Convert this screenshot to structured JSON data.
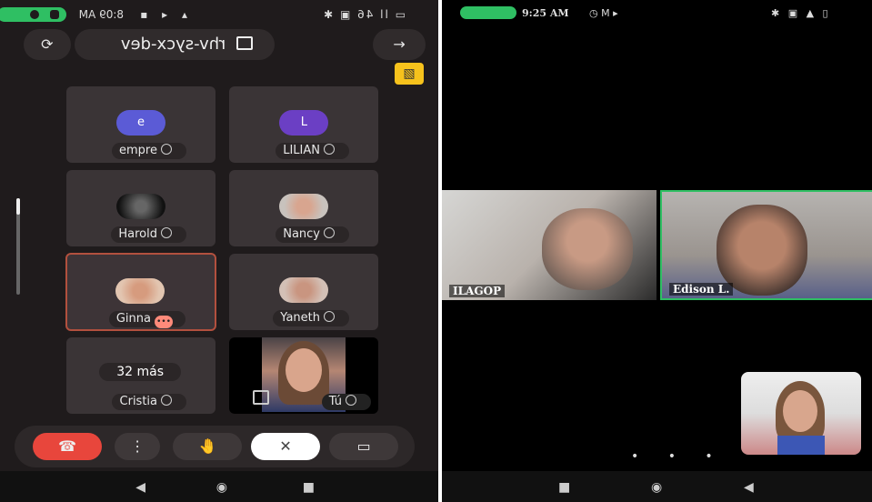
{
  "left": {
    "status": {
      "time": "8:09 AM",
      "left_icons": "▭ ll 46 ▣ ✱",
      "right_icons": "▴ ◂ ▪"
    },
    "top": {
      "meeting_code": "rhv-sycx-dev",
      "back_icon": "arrow-icon",
      "bluetooth_icon": "bluetooth-icon",
      "camera_switch_icon": "camera-switch-icon"
    },
    "tiles": [
      {
        "avatar": "e",
        "name": "empre",
        "color": "#5b5bd6"
      },
      {
        "avatar": "L",
        "name": "LILIAN",
        "color": "#6b3fc4"
      },
      {
        "avatar": "",
        "name": "Harold",
        "color": "#2b2b2b"
      },
      {
        "avatar": "",
        "name": "Nancy",
        "color": "#c8c2bd"
      },
      {
        "avatar": "",
        "name": "Ginna",
        "color": "#e2c5b0"
      },
      {
        "avatar": "",
        "name": "Yaneth",
        "color": "#d3c0b6"
      },
      {
        "avatar": "32 más",
        "name": "Cristia",
        "color": "#2f2a2b"
      },
      {
        "avatar": "",
        "name": "Tú",
        "color": ""
      }
    ],
    "controls": {
      "end_call": "☎",
      "more": "⋮",
      "hand": "✋",
      "mic": "✕",
      "screen": "▭"
    },
    "nav": {
      "back": "◀",
      "home": "◉",
      "recent": "■"
    }
  },
  "right": {
    "status": {
      "time": "9:25 AM",
      "icons_left": "◷ M ▸",
      "icons_right": "✱ ▣ ▲ ▯"
    },
    "participants": [
      {
        "name": "ILAGOP"
      },
      {
        "name": "Edison L."
      }
    ],
    "page_dots": "• • •",
    "nav": {
      "recent": "■",
      "home": "◉",
      "back": "◀"
    }
  }
}
